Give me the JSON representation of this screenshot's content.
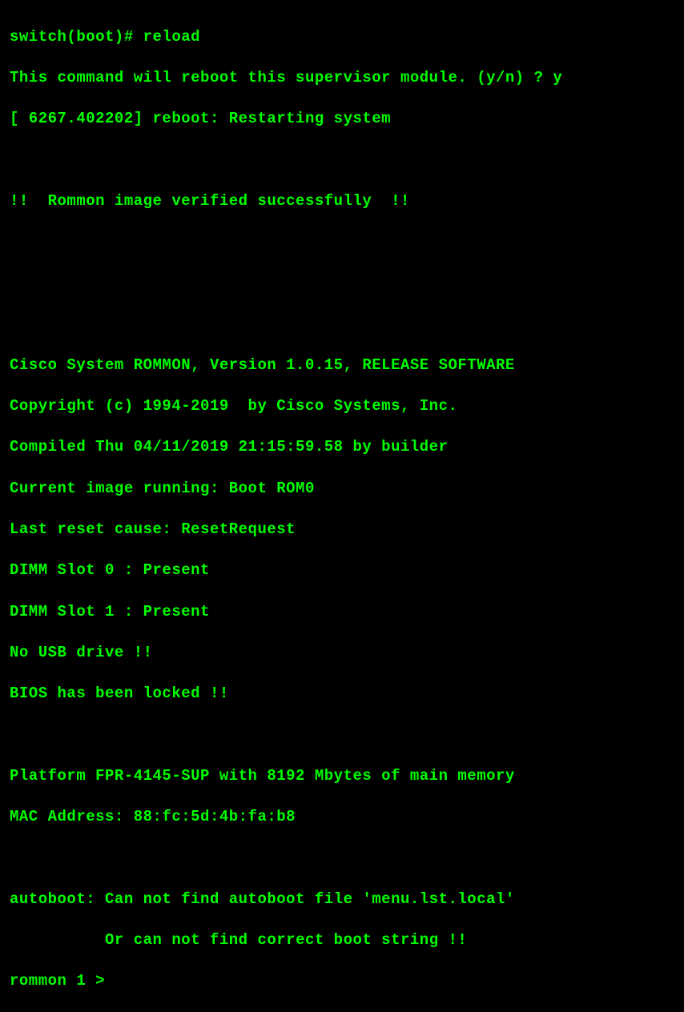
{
  "terminal": {
    "prompt1": "switch(boot)# ",
    "command1": "reload",
    "lines": [
      "This command will reboot this supervisor module. (y/n) ? y",
      "[ 6267.402202] reboot: Restarting system",
      "",
      "!!  Rommon image verified successfully  !!",
      "",
      "",
      "",
      "Cisco System ROMMON, Version 1.0.15, RELEASE SOFTWARE",
      "Copyright (c) 1994-2019  by Cisco Systems, Inc.",
      "Compiled Thu 04/11/2019 21:15:59.58 by builder",
      "Current image running: Boot ROM0",
      "Last reset cause: ResetRequest",
      "DIMM Slot 0 : Present",
      "DIMM Slot 1 : Present",
      "No USB drive !!",
      "BIOS has been locked !!",
      "",
      "Platform FPR-4145-SUP with 8192 Mbytes of main memory",
      "MAC Address: 88:fc:5d:4b:fa:b8",
      "",
      "autoboot: Can not find autoboot file 'menu.lst.local'",
      "          Or can not find correct boot string !!"
    ],
    "prompt2": "rommon 1 > "
  }
}
